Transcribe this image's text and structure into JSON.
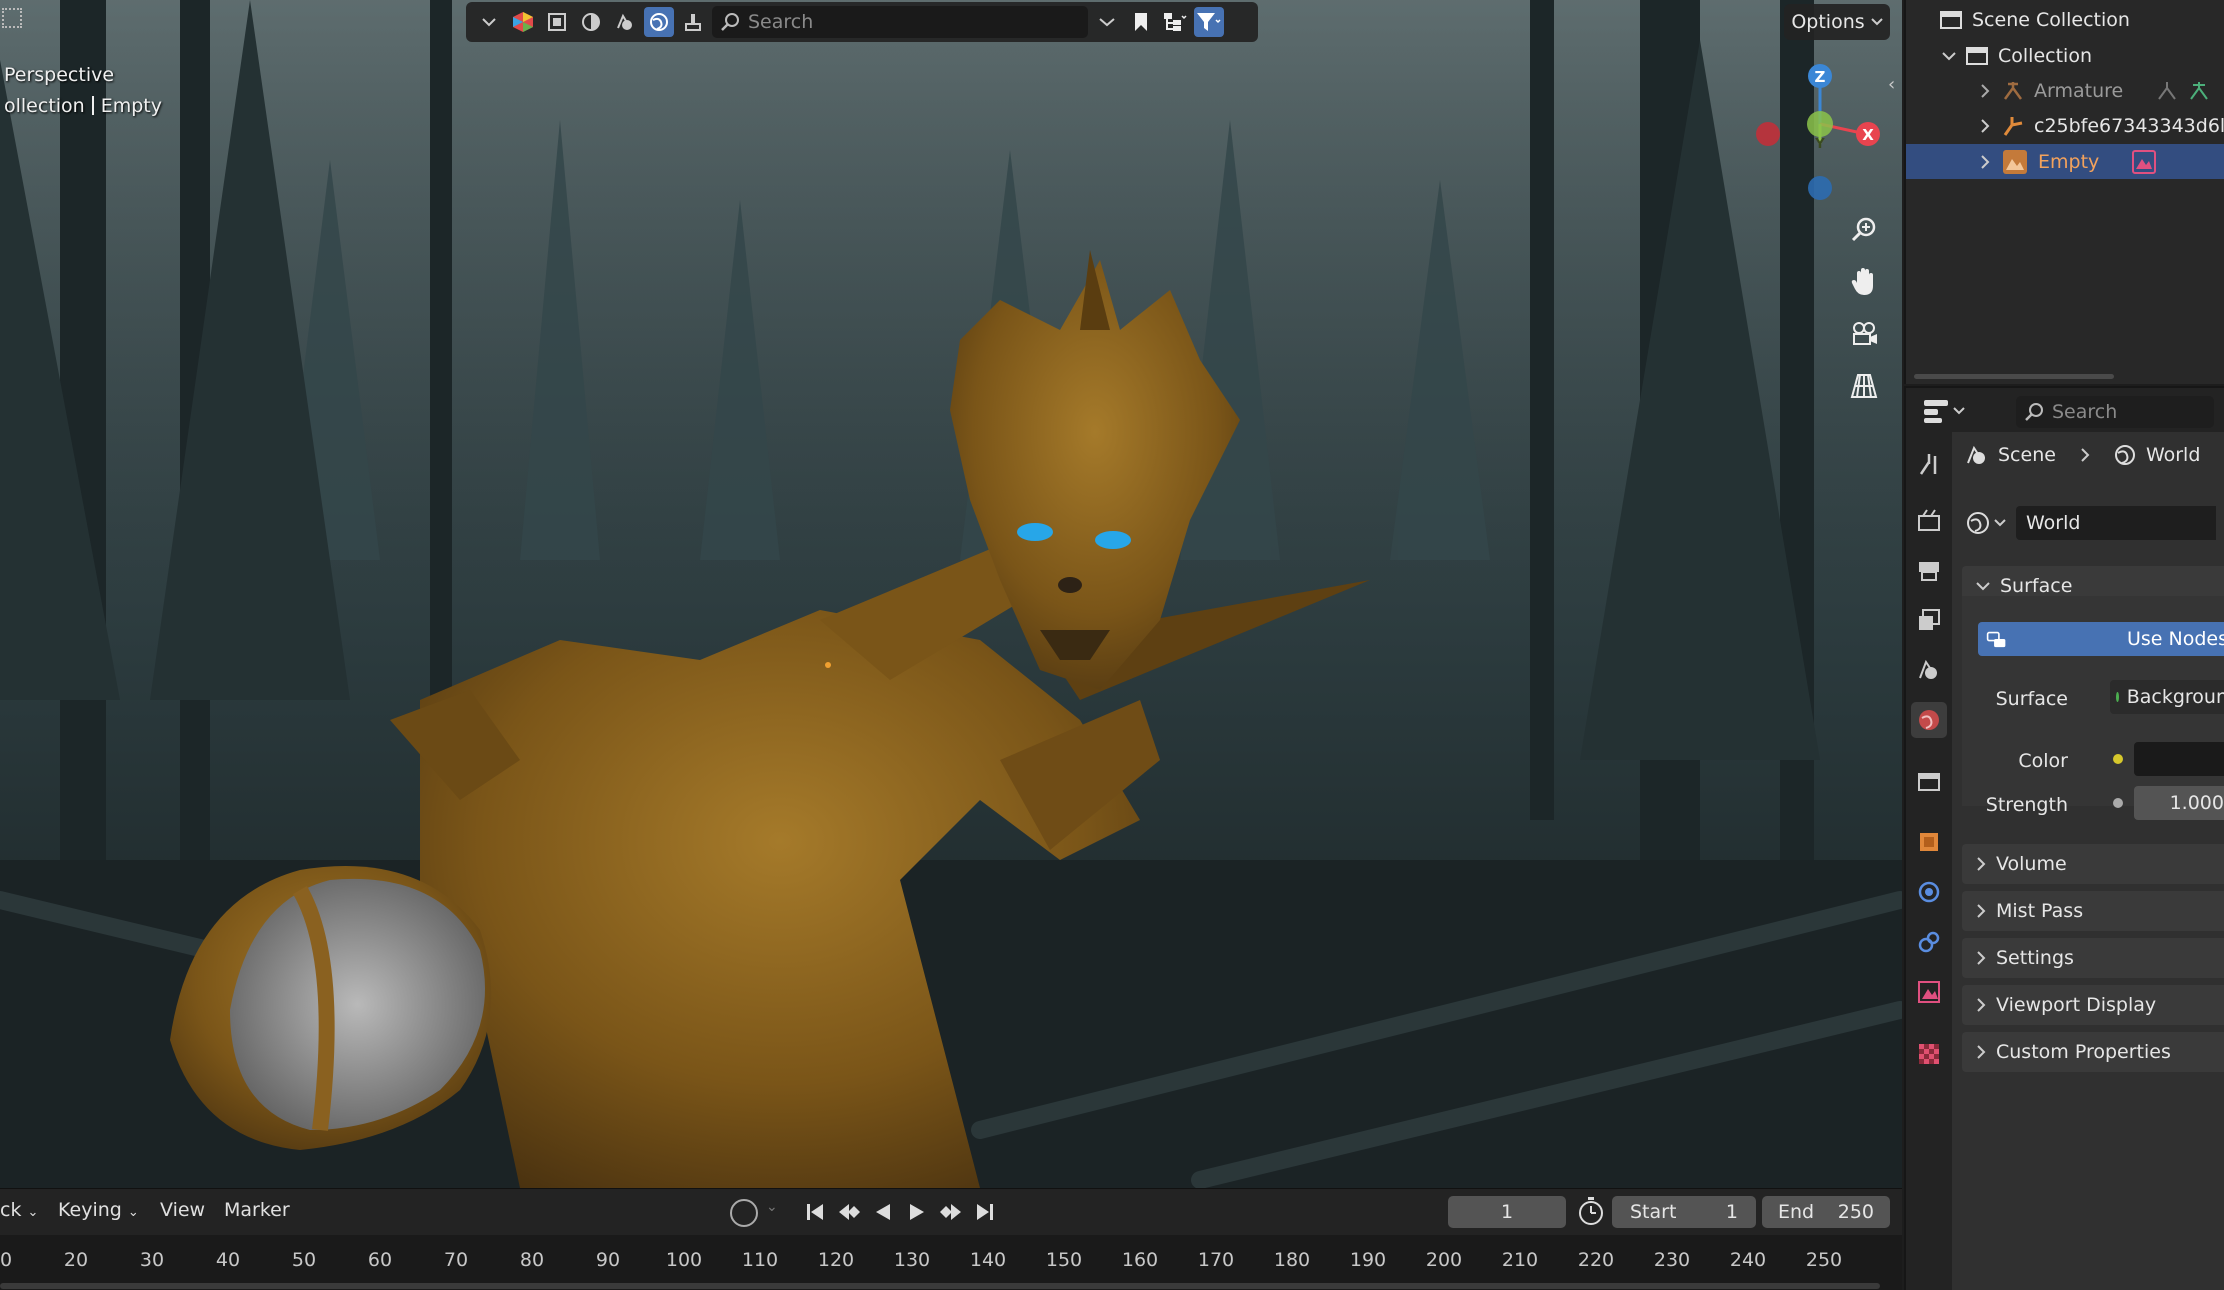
{
  "viewport": {
    "view_name": "Perspective",
    "collection_label": "ollection",
    "active_object": "Empty",
    "search_placeholder": "Search",
    "options_label": "Options",
    "gizmo": {
      "z": "Z",
      "y": "Y",
      "x": "X"
    }
  },
  "timeline": {
    "menus": [
      "ck",
      "Keying",
      "View",
      "Marker"
    ],
    "current_frame": "1",
    "start_label": "Start",
    "start_value": "1",
    "end_label": "End",
    "end_value": "250",
    "ticks": [
      "0",
      "20",
      "30",
      "40",
      "50",
      "60",
      "70",
      "80",
      "90",
      "100",
      "110",
      "120",
      "130",
      "140",
      "150",
      "160",
      "170",
      "180",
      "190",
      "200",
      "210",
      "220",
      "230",
      "240",
      "250"
    ]
  },
  "outliner": {
    "scene_collection": "Scene Collection",
    "collection": "Collection",
    "items": [
      {
        "label": "Armature"
      },
      {
        "label": "c25bfe67343343d6l"
      },
      {
        "label": "Empty"
      }
    ]
  },
  "properties": {
    "search_placeholder": "Search",
    "breadcrumb": {
      "scene": "Scene",
      "world": "World"
    },
    "world_name": "World",
    "surface_panel": "Surface",
    "use_nodes": "Use Nodes",
    "surface_label": "Surface",
    "surface_value": "Backgroun",
    "color_label": "Color",
    "strength_label": "Strength",
    "strength_value": "1.000",
    "collapsed_panels": [
      "Volume",
      "Mist Pass",
      "Settings",
      "Viewport Display",
      "Custom Properties"
    ]
  },
  "colors": {
    "accent": "#4772b3",
    "selected_row": "#334d80",
    "axis_x": "#e8444f",
    "axis_y": "#8bc34a",
    "axis_z": "#3b87d6"
  }
}
